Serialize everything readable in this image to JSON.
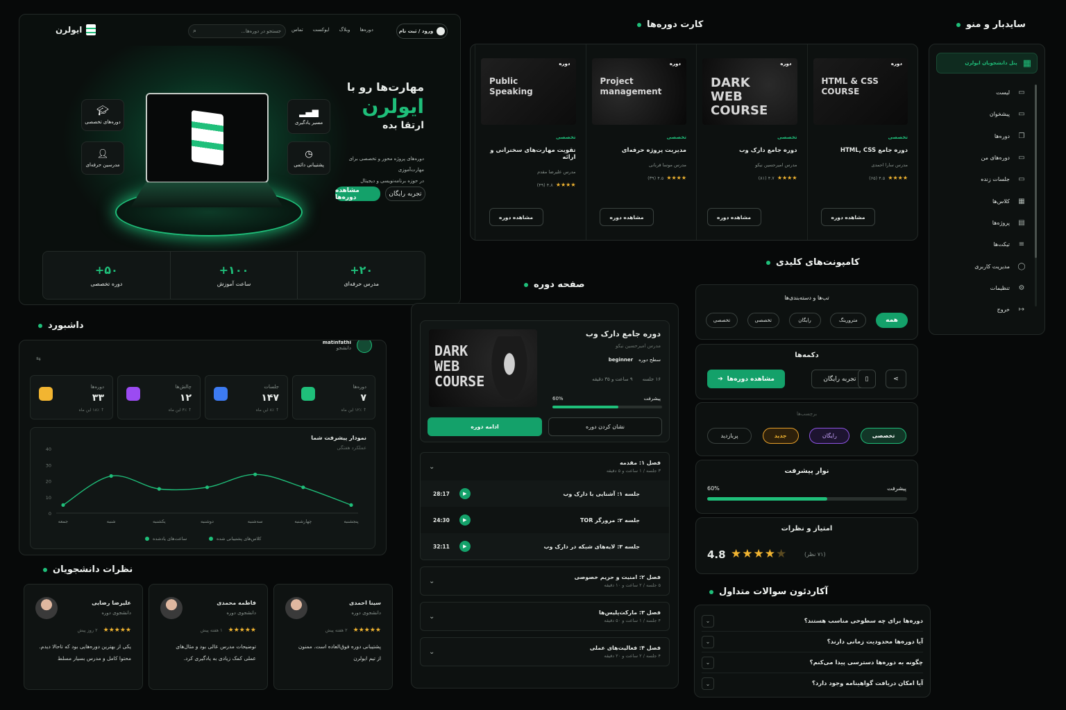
{
  "hero": {
    "brand": "ایولرن",
    "login": "ورود / ثبت نام",
    "search_placeholder": "جستجو در دوره‌ها...",
    "nav": [
      "دوره‌ها",
      "وبلاگ",
      "ایوکست",
      "تماس"
    ],
    "headline1": "مهارت‌ها رو با",
    "headline2": "ایولرن",
    "headline3": "ارتقا بده",
    "desc1": "دوره‌های پروژه‌ محور و تخصصی برای مهارت‌آموزی",
    "desc2": "در حوزه برنامه‌نویسی و دیجیتال",
    "cta_primary": "مشاهده دوره‌ها",
    "cta_secondary": "تجربه رایگان",
    "features": [
      "دوره‌های تخصصی",
      "مسیر یادگیری",
      "مدرسین حرفه‌ای",
      "پشتیبانی دائمی"
    ],
    "stats": [
      {
        "value": "۲۰+",
        "label": "مدرس حرفه‌ای"
      },
      {
        "value": "۱۰۰+",
        "label": "ساعت آموزش"
      },
      {
        "value": "۵۰+",
        "label": "دوره تخصصی"
      }
    ]
  },
  "course_cards": {
    "title": "کارت دوره‌ها",
    "tag": "دوره",
    "badge": "تخصصی",
    "view_label": "مشاهده دوره",
    "items": [
      {
        "cover": "HTML & CSS COURSE",
        "title": "دوره جامع HTML, CSS",
        "teacher": "مدرس سارا احمدی",
        "rating": "۴.۵ (۶۵)"
      },
      {
        "cover": "DARK WEB COURSE",
        "title": "دوره جامع دارک وب",
        "teacher": "مدرس امیرحسین نیکو",
        "rating": "۴.۷ (۸۱)"
      },
      {
        "cover": "Project management",
        "title": "مدیریت پروژه حرفه‌ای",
        "teacher": "مدرس موسا قربانی",
        "rating": "۴.۵ (۳۹)"
      },
      {
        "cover": "Public Speaking",
        "title": "تقویت مهارت‌های سخنرانی و ارائه",
        "teacher": "مدرس علیرضا مقدم",
        "rating": "۴.۸ (۴۹)"
      }
    ]
  },
  "sidebar": {
    "title": "سایدبار و منو",
    "panel": "پنل دانشجویان ایولرن",
    "items": [
      "لیست",
      "پیشخوان",
      "دوره‌ها",
      "دوره‌های من",
      "جلسات زنده",
      "کلاس‌ها",
      "پروژه‌ها",
      "تیکت‌ها",
      "مدیریت کاربری",
      "تنظیمات",
      "خروج"
    ]
  },
  "components": {
    "title": "کامپونت‌های کلیدی",
    "tabs_title": "تب‌ها و دسته‌بندی‌ها",
    "tabs": [
      "همه",
      "مترورینگ",
      "رایگان",
      "تخصصی",
      "تخصصی"
    ],
    "buttons_title": "دکمه‌ها",
    "btn_primary": "مشاهده دوره‌ها",
    "btn_secondary": "تجربه رایگان",
    "tags_title": "برچسب‌ها",
    "tags": [
      "تخصصی",
      "رایگان",
      "جدید",
      "پربازدید"
    ],
    "progress_title": "نوار پیشرفت",
    "progress_label": "پیشرفت",
    "progress_value_text": "60%",
    "progress_value": 0.6,
    "rating_title": "امتیاز و نظرات",
    "rating_value": "4.8",
    "rating_count": "(۷۱ نظر)",
    "rating_stars": 4.5
  },
  "faq": {
    "title": "آکاردئون سوالات متداول",
    "items": [
      "دوره‌ها برای چه سطوحی مناسب هستند؟",
      "آیا دوره‌ها محدودیت زمانی دارند؟",
      "چگونه به دوره‌ها دسترسی پیدا می‌کنم؟",
      "آیا امکان دریافت گواهینامه وجود دارد؟"
    ]
  },
  "course_page": {
    "title": "صفحه دوره",
    "course_title": "دوره جامع دارک وب",
    "teacher": "مدرس امیرحسین نیکو",
    "level_label": "سطح دوره",
    "level": "beginner",
    "sessions": "۱۶ جلسه",
    "duration": "۹ ساعت و ۳۵ دقیقه",
    "progress_label": "پیشرفت",
    "progress_text": "60%",
    "progress_value": 0.6,
    "continue": "ادامه دوره",
    "bookmark": "نشان کردن دوره",
    "cover": "DARK WEB COURSE",
    "chapters": [
      {
        "title": "فصل ۱: مقدمه",
        "meta": "۳ جلسه / ۱ ساعت و ۵ دقیقه",
        "open": true,
        "lessons": [
          {
            "title": "جلسه ۱: آشنایی با دارک وب",
            "time": "28:17"
          },
          {
            "title": "جلسه ۲: مرورگر TOR",
            "time": "24:30"
          },
          {
            "title": "جلسه ۳: لایه‌های شبکه در دارک وب",
            "time": "32:11"
          }
        ]
      },
      {
        "title": "فصل ۲: امنیت و حریم خصوصی",
        "meta": "۵ جلسه / ۲ ساعت و ۱۰ دقیقه",
        "open": false,
        "lessons": []
      },
      {
        "title": "فصل ۳: مارکت‌پلیس‌ها",
        "meta": "۴ جلسه / ۱ ساعت و ۵۰ دقیقه",
        "open": false,
        "lessons": []
      },
      {
        "title": "فصل ۴: فعالیت‌های عملی",
        "meta": "۴ جلسه / ۲ ساعت و ۲۰ دقیقه",
        "open": false,
        "lessons": []
      }
    ]
  },
  "dashboard": {
    "title": "داشبورد",
    "user": "matinfathi",
    "role": "دانشجو",
    "stats": [
      {
        "label": "دوره‌ها",
        "value": "۷",
        "delta": "↑ ۱۲٪ این ماه",
        "color": "#1fbf7a"
      },
      {
        "label": "جلسات",
        "value": "۱۴۷",
        "delta": "↑ ۸٪ این ماه",
        "color": "#3d7bf2"
      },
      {
        "label": "چالش‌ها",
        "value": "۱۲",
        "delta": "↑ ۴٪ این ماه",
        "color": "#9b4bf2"
      },
      {
        "label": "دوره‌ها",
        "value": "۳۳",
        "delta": "↑ ۱۸٪ این ماه",
        "color": "#f2b531"
      }
    ],
    "chart_title": "نمودار پیشرفت شما",
    "chart_subtitle": "عملکرد هفتگی",
    "legend": [
      "کلاس‌های پشتیبانی شده",
      "ساعت‌های یادشده"
    ]
  },
  "chart_data": {
    "type": "line",
    "categories": [
      "پنجشنبه",
      "چهارشنبه",
      "سه‌شنبه",
      "دوشنبه",
      "یکشنبه",
      "شنبه",
      "جمعه"
    ],
    "values": [
      5,
      23,
      15,
      16,
      24,
      16,
      5
    ],
    "ylim": [
      0,
      40
    ],
    "yticks": [
      0,
      10,
      20,
      30,
      40
    ],
    "grid": false,
    "legend": "bottom"
  },
  "reviews": {
    "title": "نظرات دانشجویان",
    "role": "دانشجوی دوره",
    "items": [
      {
        "name": "سینا احمدی",
        "time": "۲ هفته پیش",
        "text1": "پشتیبانی دوره فوق‌العاده است. ممنون",
        "text2": "از تیم ایولرن"
      },
      {
        "name": "فاطمه محمدی",
        "time": "۱ هفته پیش",
        "text1": "توضیحات مدرس عالی بود و مثال‌های",
        "text2": "عملی کمک زیادی به یادگیری کرد."
      },
      {
        "name": "علیرضا رضایی",
        "time": "۲ روز پیش",
        "text1": "یکی از بهترین دوره‌هایی بود که تاحالا دیدم.",
        "text2": "محتوا کامل و مدرس بسیار مسلط"
      }
    ]
  }
}
